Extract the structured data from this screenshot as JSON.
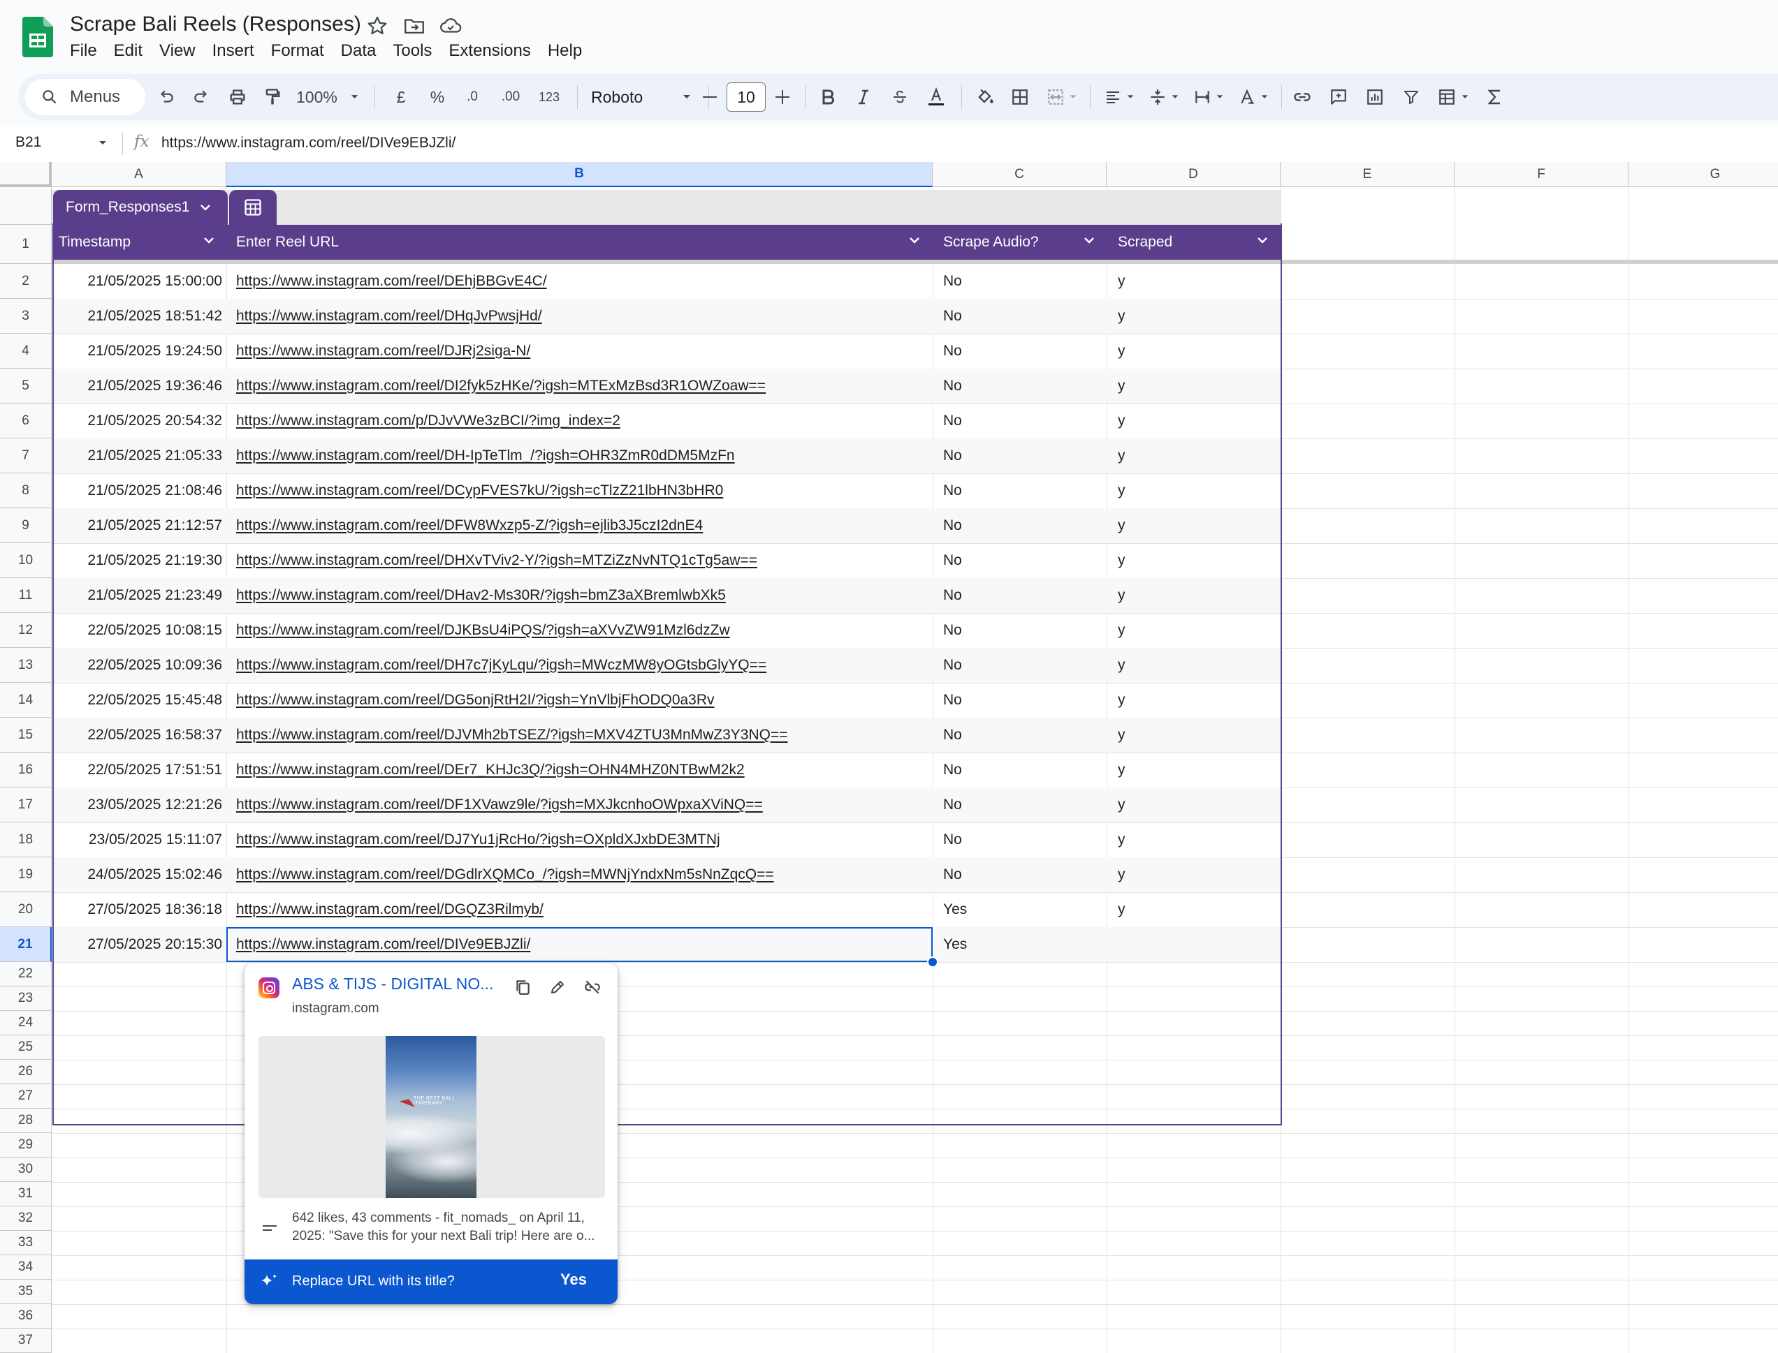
{
  "app": {
    "title": "Scrape Bali Reels (Responses)",
    "menu": [
      "File",
      "Edit",
      "View",
      "Insert",
      "Format",
      "Data",
      "Tools",
      "Extensions",
      "Help"
    ]
  },
  "toolbar": {
    "menus_label": "Menus",
    "zoom": "100%",
    "currency": "£",
    "percent": "%",
    "dec_decrease": ".0",
    "dec_increase": ".00",
    "number_format": "123",
    "font_family": "Roboto",
    "font_size": "10"
  },
  "formula_bar": {
    "cell_ref": "B21",
    "fx": "fx",
    "value": "https://www.instagram.com/reel/DIVe9EBJZli/"
  },
  "grid": {
    "columns": [
      "A",
      "B",
      "C",
      "D",
      "E",
      "F",
      "G"
    ],
    "selected_column": "B",
    "selected_row": "21",
    "rows": [
      "1",
      "2",
      "3",
      "4",
      "5",
      "6",
      "7",
      "8",
      "9",
      "10",
      "11",
      "12",
      "13",
      "14",
      "15",
      "16",
      "17",
      "18",
      "19",
      "20",
      "21",
      "22",
      "23",
      "24",
      "25",
      "26",
      "27",
      "28",
      "29",
      "30",
      "31",
      "32",
      "33",
      "34",
      "35",
      "36",
      "37"
    ]
  },
  "table": {
    "name": "Form_Responses1",
    "headers": [
      "Timestamp",
      "Enter Reel URL",
      "Scrape Audio?",
      "Scraped"
    ],
    "rows": [
      {
        "ts": "21/05/2025 15:00:00",
        "url": "https://www.instagram.com/reel/DEhjBBGvE4C/",
        "audio": "No",
        "scraped": "y"
      },
      {
        "ts": "21/05/2025 18:51:42",
        "url": "https://www.instagram.com/reel/DHqJvPwsjHd/",
        "audio": "No",
        "scraped": "y"
      },
      {
        "ts": "21/05/2025 19:24:50",
        "url": "https://www.instagram.com/reel/DJRj2siga-N/",
        "audio": "No",
        "scraped": "y"
      },
      {
        "ts": "21/05/2025 19:36:46",
        "url": "https://www.instagram.com/reel/DI2fyk5zHKe/?igsh=MTExMzBsd3R1OWZoaw==",
        "audio": "No",
        "scraped": "y"
      },
      {
        "ts": "21/05/2025 20:54:32",
        "url": "https://www.instagram.com/p/DJvVWe3zBCI/?img_index=2",
        "audio": "No",
        "scraped": "y"
      },
      {
        "ts": "21/05/2025 21:05:33",
        "url": "https://www.instagram.com/reel/DH-IpTeTlm_/?igsh=OHR3ZmR0dDM5MzFn",
        "audio": "No",
        "scraped": "y"
      },
      {
        "ts": "21/05/2025 21:08:46",
        "url": "https://www.instagram.com/reel/DCypFVES7kU/?igsh=cTlzZ21lbHN3bHR0",
        "audio": "No",
        "scraped": "y"
      },
      {
        "ts": "21/05/2025 21:12:57",
        "url": "https://www.instagram.com/reel/DFW8Wxzp5-Z/?igsh=ejlib3J5czI2dnE4",
        "audio": "No",
        "scraped": "y"
      },
      {
        "ts": "21/05/2025 21:19:30",
        "url": "https://www.instagram.com/reel/DHXvTViv2-Y/?igsh=MTZiZzNvNTQ1cTg5aw==",
        "audio": "No",
        "scraped": "y"
      },
      {
        "ts": "21/05/2025 21:23:49",
        "url": "https://www.instagram.com/reel/DHav2-Ms30R/?igsh=bmZ3aXBremlwbXk5",
        "audio": "No",
        "scraped": "y"
      },
      {
        "ts": "22/05/2025 10:08:15",
        "url": "https://www.instagram.com/reel/DJKBsU4iPQS/?igsh=aXVvZW91Mzl6dzZw",
        "audio": "No",
        "scraped": "y"
      },
      {
        "ts": "22/05/2025 10:09:36",
        "url": "https://www.instagram.com/reel/DH7c7jKyLqu/?igsh=MWczMW8yOGtsbGlyYQ==",
        "audio": "No",
        "scraped": "y"
      },
      {
        "ts": "22/05/2025 15:45:48",
        "url": "https://www.instagram.com/reel/DG5onjRtH2I/?igsh=YnVlbjFhODQ0a3Rv",
        "audio": "No",
        "scraped": "y"
      },
      {
        "ts": "22/05/2025 16:58:37",
        "url": "https://www.instagram.com/reel/DJVMh2bTSEZ/?igsh=MXV4ZTU3MnMwZ3Y3NQ==",
        "audio": "No",
        "scraped": "y"
      },
      {
        "ts": "22/05/2025 17:51:51",
        "url": "https://www.instagram.com/reel/DEr7_KHJc3Q/?igsh=OHN4MHZ0NTBwM2k2",
        "audio": "No",
        "scraped": "y"
      },
      {
        "ts": "23/05/2025 12:21:26",
        "url": "https://www.instagram.com/reel/DF1XVawz9le/?igsh=MXJkcnhoOWpxaXViNQ==",
        "audio": "No",
        "scraped": "y"
      },
      {
        "ts": "23/05/2025 15:11:07",
        "url": "https://www.instagram.com/reel/DJ7Yu1jRcHo/?igsh=OXpldXJxbDE3MTNj",
        "audio": "No",
        "scraped": "y"
      },
      {
        "ts": "24/05/2025 15:02:46",
        "url": "https://www.instagram.com/reel/DGdlrXQMCo_/?igsh=MWNjYndxNm5sNnZqcQ==",
        "audio": "No",
        "scraped": "y"
      },
      {
        "ts": "27/05/2025 18:36:18",
        "url": "https://www.instagram.com/reel/DGQZ3Rilmyb/",
        "audio": "Yes",
        "scraped": "y"
      },
      {
        "ts": "27/05/2025 20:15:30",
        "url": "https://www.instagram.com/reel/DIVe9EBJZli/",
        "audio": "Yes",
        "scraped": ""
      }
    ]
  },
  "link_preview": {
    "title": "ABS & TIJS - DIGITAL NO...",
    "domain": "instagram.com",
    "thumbnail_text": "THE BEST BALI ITINERARY",
    "description_line1": "642 likes, 43 comments - fit_nomads_ on April 11,",
    "description_line2": "2025: \"Save this for your next Bali trip! Here are o...",
    "replace_label": "Replace URL with its title?",
    "yes_label": "Yes"
  },
  "colors": {
    "table_header": "#5a3e8c",
    "selection": "#0b57d0",
    "sheets_green": "#0f9d58"
  }
}
